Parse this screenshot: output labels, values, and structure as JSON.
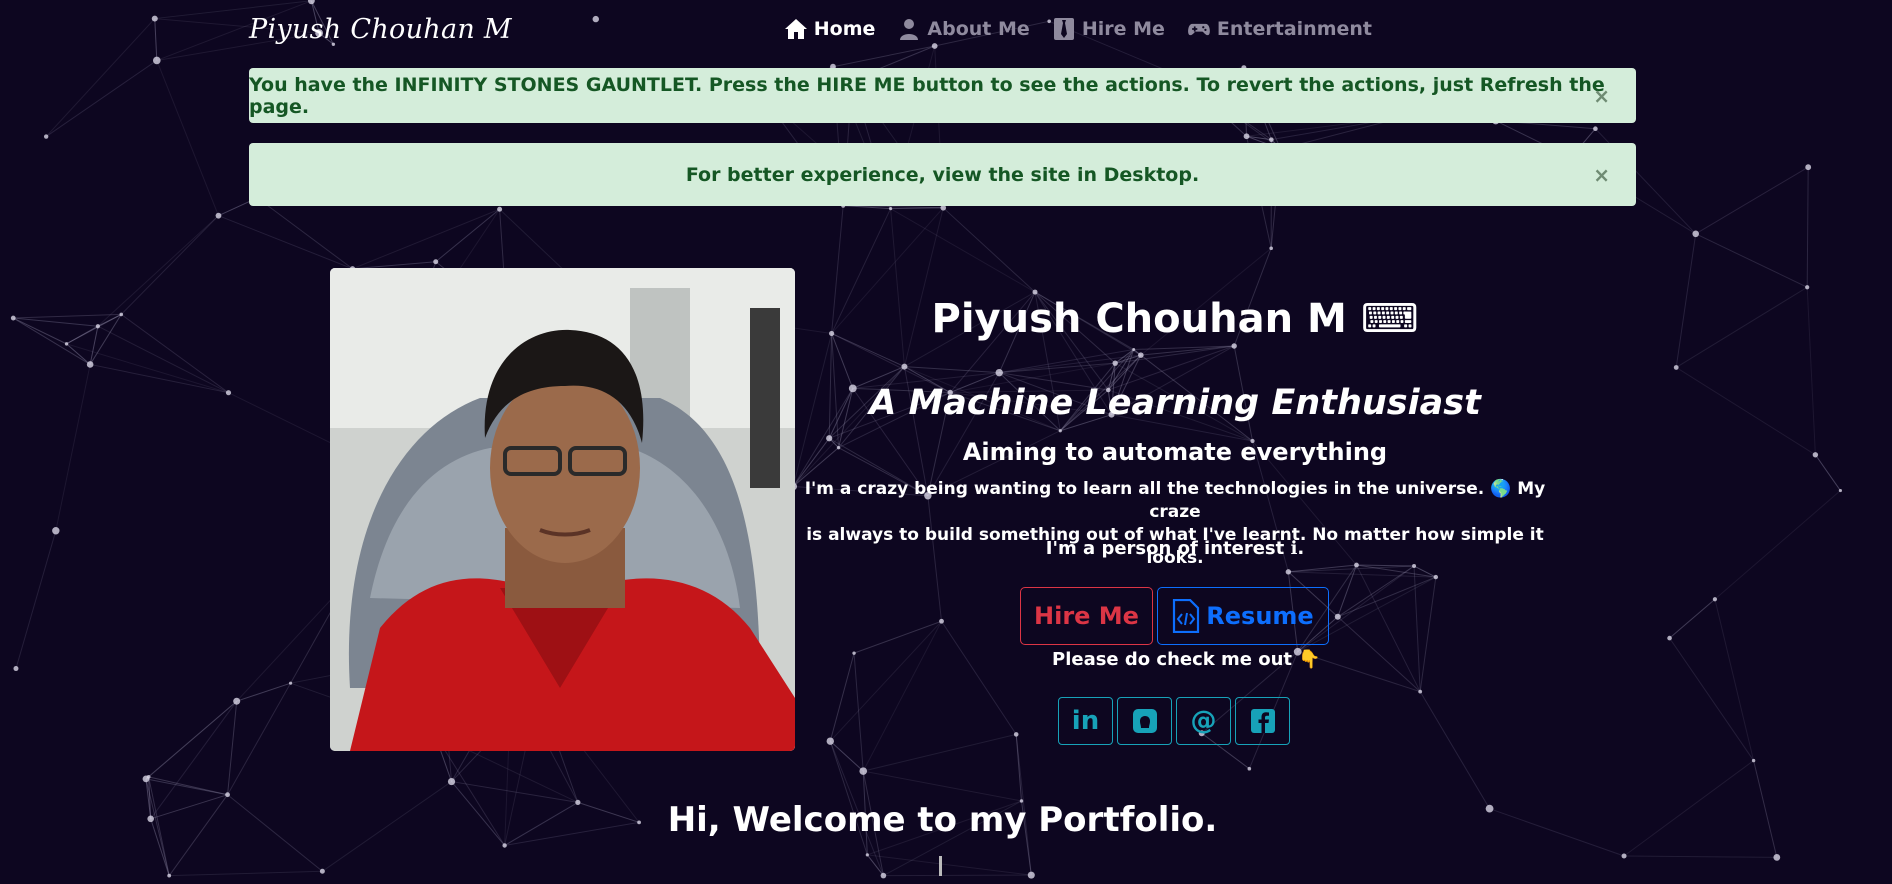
{
  "brand": "Piyush Chouhan M",
  "nav": [
    {
      "label": "Home",
      "icon": "home-icon",
      "active": true
    },
    {
      "label": "About Me",
      "icon": "user-icon",
      "active": false
    },
    {
      "label": "Hire Me",
      "icon": "tie-icon",
      "active": false
    },
    {
      "label": "Entertainment",
      "icon": "gamepad-icon",
      "active": false
    }
  ],
  "alerts": [
    {
      "text": "You have the INFINITY STONES GAUNTLET. Press the HIRE ME button to see the actions. To revert the actions, just Refresh the page.",
      "close": "×"
    },
    {
      "text": "For better experience, view the site in Desktop.",
      "close": "×"
    }
  ],
  "profile": {
    "name": "Piyush Chouhan M",
    "name_icon": "⌨",
    "tagline": "A Machine Learning Enthusiast",
    "subtitle": "Aiming to automate everything",
    "description_line1": "I'm a crazy being wanting to learn all the technologies in the universe. 🌎 My craze",
    "description_line2": "is always to build something out of what I've learnt. No matter how simple it looks.",
    "interest": "I'm a person of interest ℹ."
  },
  "buttons": {
    "hire": "Hire Me",
    "resume": "Resume"
  },
  "checkout": "Please do check me out 👇",
  "social": [
    {
      "label": "in",
      "icon": "linkedin-icon"
    },
    {
      "label": "",
      "icon": "github-icon"
    },
    {
      "label": "@",
      "icon": "email-icon"
    },
    {
      "label": "",
      "icon": "facebook-icon"
    }
  ],
  "welcome": "Hi, Welcome to my Portfolio.",
  "colors": {
    "background": "#0d0620",
    "alert_bg": "#d4edda",
    "alert_text": "#155724",
    "hire": "#dc3545",
    "resume": "#0d6efd",
    "social": "#17a2b8"
  }
}
